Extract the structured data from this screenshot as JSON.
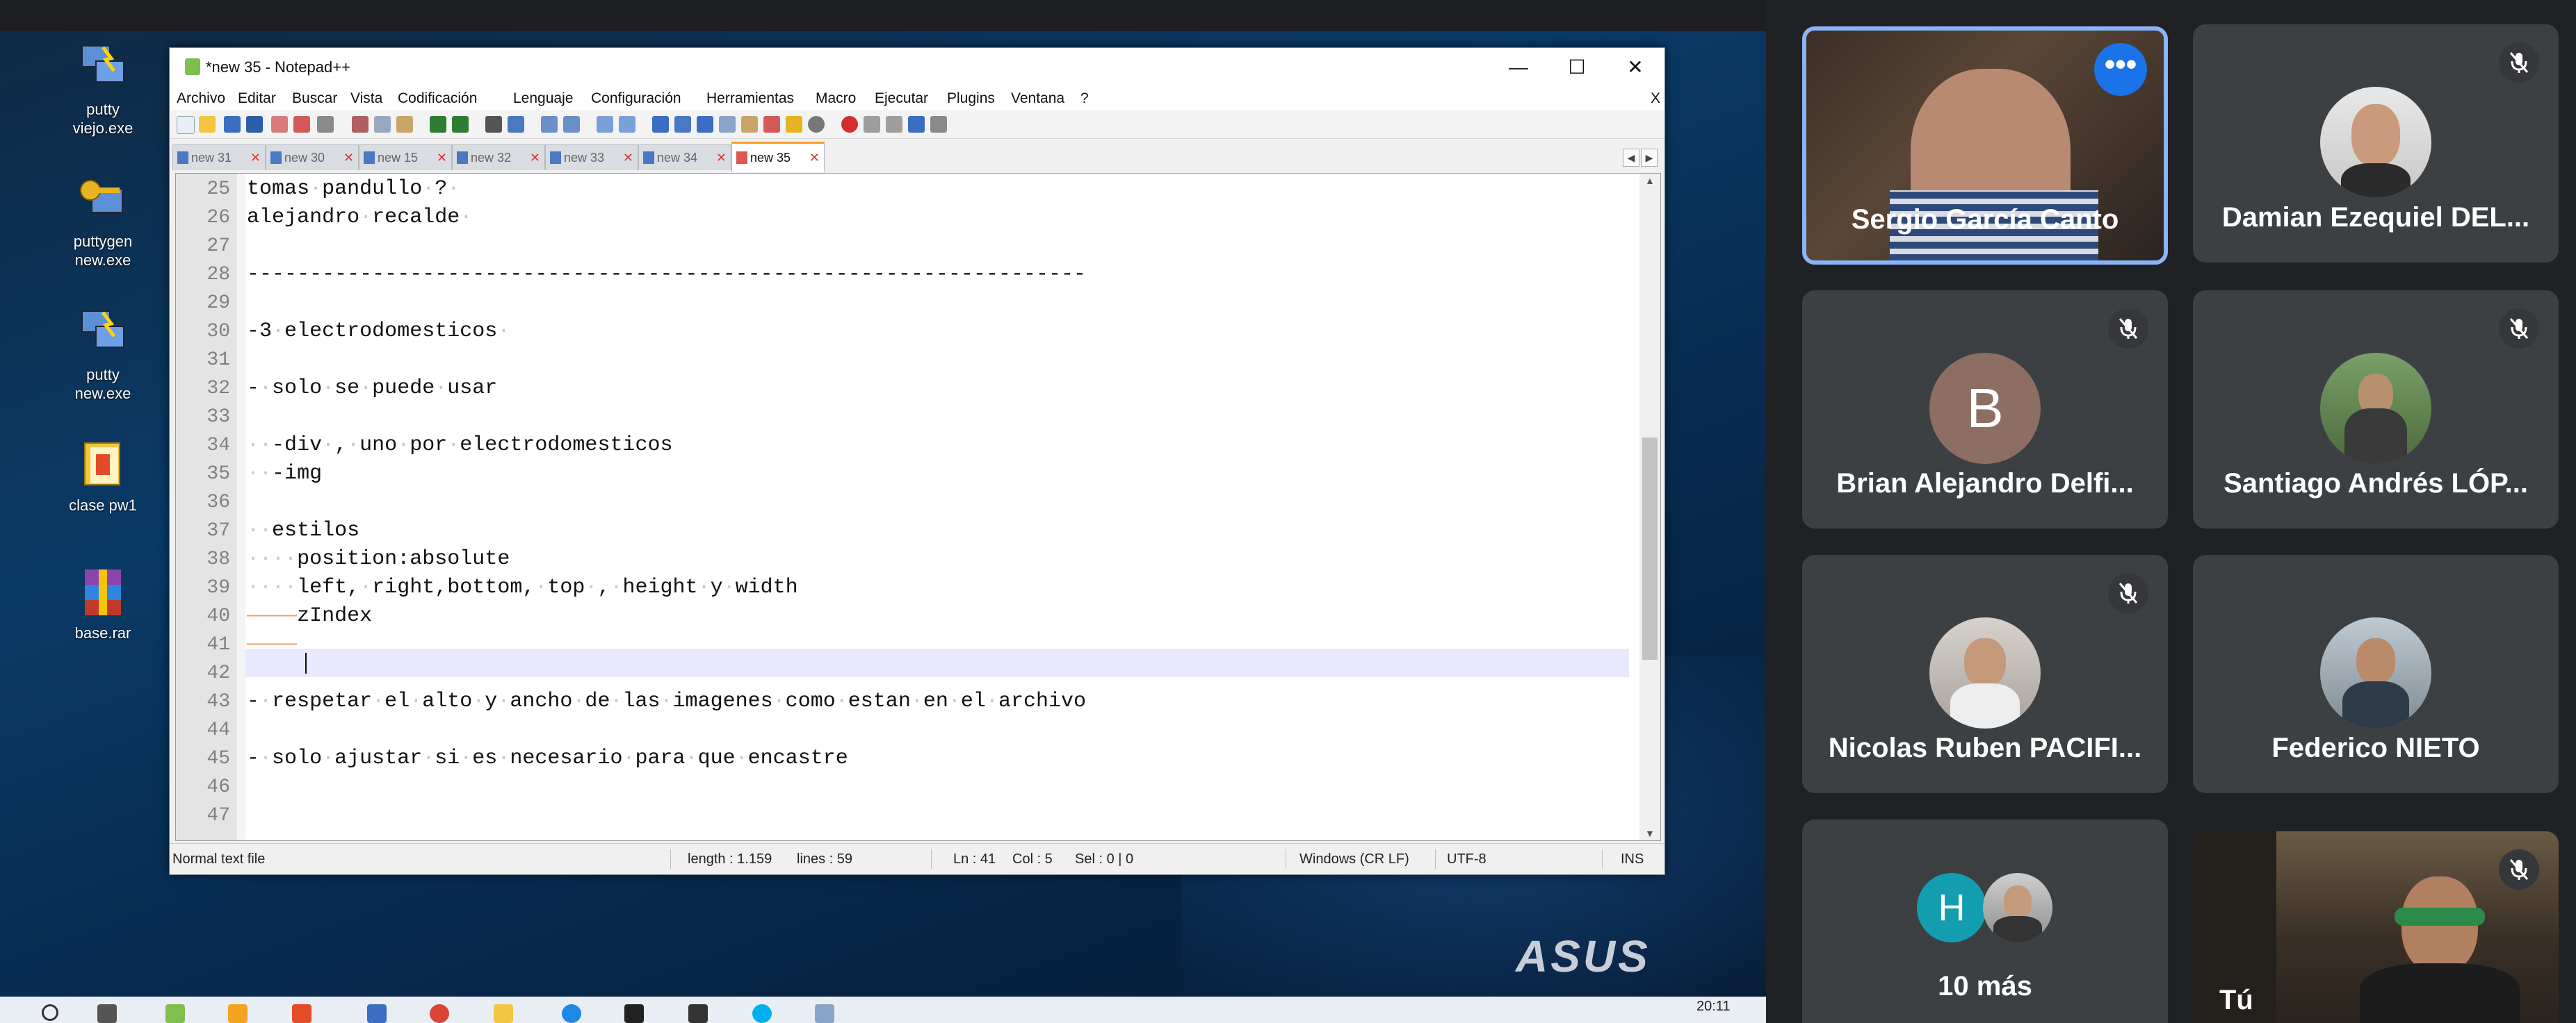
{
  "desktop": {
    "icons": [
      {
        "label1": "putty",
        "label2": "viejo.exe"
      },
      {
        "label1": "puttygen",
        "label2": "new.exe"
      },
      {
        "label1": "putty",
        "label2": "new.exe"
      },
      {
        "label1": "clase pw1",
        "label2": ""
      },
      {
        "label1": "base.rar",
        "label2": ""
      }
    ],
    "brand": "ASUS",
    "clock": "20:11"
  },
  "notepad": {
    "title": "*new 35 - Notepad++",
    "window_controls": {
      "minimize": "—",
      "maximize": "☐",
      "close": "✕"
    },
    "menu": [
      "Archivo",
      "Editar",
      "Buscar",
      "Vista",
      "Codificación",
      "Lenguaje",
      "Configuración",
      "Herramientas",
      "Macro",
      "Ejecutar",
      "Plugins",
      "Ventana",
      "?"
    ],
    "menu_close": "X",
    "tabs": [
      "new 31",
      "new 30",
      "new 15",
      "new 32",
      "new 33",
      "new 34",
      "new 35"
    ],
    "active_tab": "new 35",
    "lines": [
      {
        "n": "25",
        "text": "tomas·pandullo·?·"
      },
      {
        "n": "26",
        "text": "alejandro·recalde·"
      },
      {
        "n": "27",
        "text": ""
      },
      {
        "n": "28",
        "text": "-------------------------------------------------------------------"
      },
      {
        "n": "29",
        "text": ""
      },
      {
        "n": "30",
        "text": "-3·electrodomesticos·"
      },
      {
        "n": "31",
        "text": ""
      },
      {
        "n": "32",
        "text": "-·solo·se·puede·usar"
      },
      {
        "n": "33",
        "text": ""
      },
      {
        "n": "34",
        "text": "··-div·,·uno·por·electrodomesticos"
      },
      {
        "n": "35",
        "text": "··-img"
      },
      {
        "n": "36",
        "text": ""
      },
      {
        "n": "37",
        "text": "··estilos"
      },
      {
        "n": "38",
        "text": "····position:absolute"
      },
      {
        "n": "39",
        "text": "····left,·right,bottom,·top·,·height·y·width"
      },
      {
        "n": "40",
        "text": "————zIndex"
      },
      {
        "n": "41",
        "text": "————"
      },
      {
        "n": "42",
        "text": ""
      },
      {
        "n": "43",
        "text": "-·respetar·el·alto·y·ancho·de·las·imagenes·como·estan·en·el·archivo"
      },
      {
        "n": "44",
        "text": ""
      },
      {
        "n": "45",
        "text": "-·solo·ajustar·si·es·necesario·para·que·encastre"
      },
      {
        "n": "46",
        "text": ""
      },
      {
        "n": "47",
        "text": ""
      }
    ],
    "status": {
      "type": "Normal text file",
      "length": "length : 1.159",
      "lines": "lines : 59",
      "ln": "Ln : 41",
      "col": "Col : 5",
      "sel": "Sel : 0 | 0",
      "eol": "Windows (CR LF)",
      "encoding": "UTF-8",
      "mode": "INS"
    }
  },
  "meet": {
    "participants": [
      {
        "name": "Sergio García Canto",
        "muted": false,
        "kind": "video",
        "speaking": true
      },
      {
        "name": "Damian Ezequiel DEL...",
        "muted": true,
        "kind": "photo"
      },
      {
        "name": "Brian Alejandro Delfi...",
        "muted": true,
        "kind": "initial",
        "initial": "B",
        "color": "#8d6e63"
      },
      {
        "name": "Santiago Andrés LÓP...",
        "muted": true,
        "kind": "photo"
      },
      {
        "name": "Nicolas Ruben PACIFI...",
        "muted": true,
        "kind": "photo"
      },
      {
        "name": "Federico NIETO",
        "muted": false,
        "kind": "photo"
      },
      {
        "name": "10 más",
        "muted": false,
        "kind": "group",
        "initial": "H",
        "color": "#129eaf"
      },
      {
        "name": "Tú",
        "muted": true,
        "kind": "video"
      }
    ],
    "colors": {
      "accent": "#1a73e8",
      "tile": "#3c4043",
      "background": "#202124"
    }
  }
}
